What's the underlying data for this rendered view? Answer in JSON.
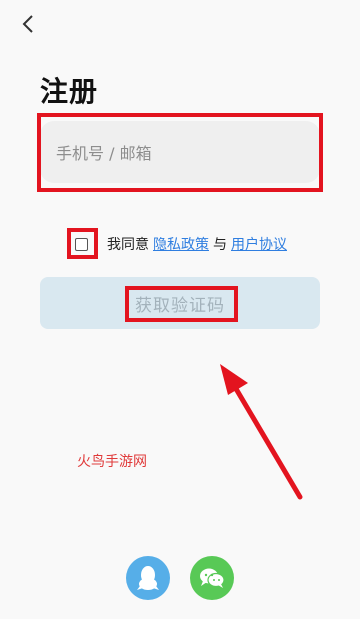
{
  "header": {
    "title": "注册"
  },
  "form": {
    "phone_placeholder": "手机号 / 邮箱",
    "agree_prefix": "我同意",
    "privacy_link": "隐私政策",
    "agree_joiner": "与",
    "user_agreement_link": "用户协议",
    "get_code_label": "获取验证码"
  },
  "watermark": {
    "text": "火鸟手游网"
  },
  "social": {
    "qq_icon": "qq-penguin-icon",
    "wechat_icon": "wechat-bubbles-icon"
  },
  "colors": {
    "annotation_red": "#e3141f",
    "link_blue": "#2f7ee0",
    "button_bg": "#d9e8f0",
    "qq_blue": "#56aee8",
    "wechat_green": "#58c956"
  }
}
